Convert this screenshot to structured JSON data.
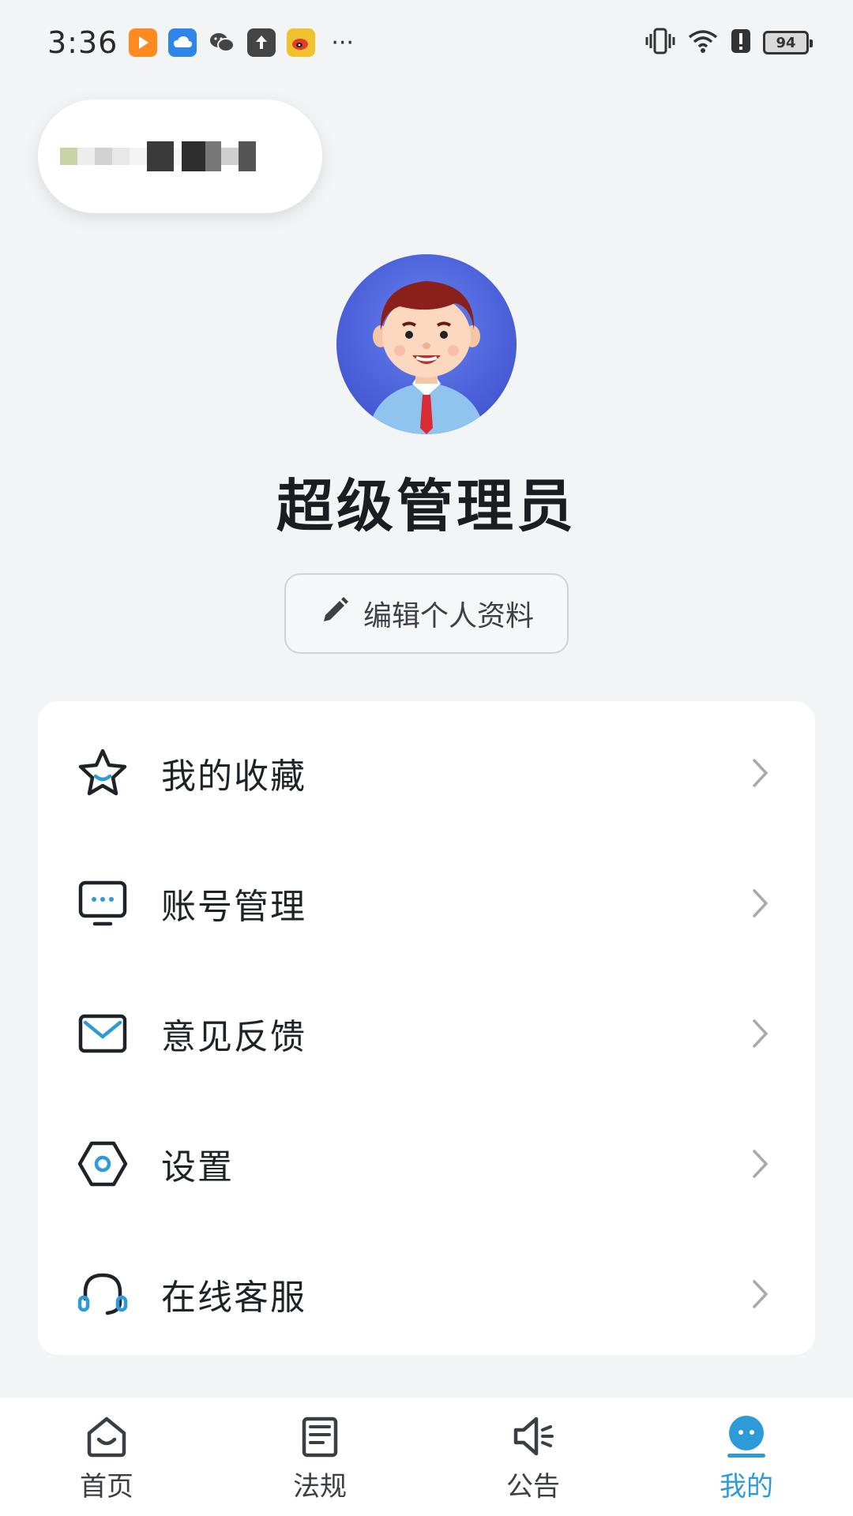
{
  "status_bar": {
    "time": "3:36",
    "battery": "94",
    "more": "···",
    "app_icons": [
      "video-app-icon",
      "cloud-icon",
      "wechat-icon",
      "upload-icon",
      "weibo-icon"
    ],
    "system_icons": [
      "vibrate-icon",
      "wifi-icon",
      "alert-icon",
      "battery-icon"
    ]
  },
  "profile": {
    "name": "超级管理员",
    "edit_label": "编辑个人资料"
  },
  "menu": {
    "items": [
      {
        "label": "我的收藏",
        "icon": "star-icon"
      },
      {
        "label": "账号管理",
        "icon": "monitor-chat-icon"
      },
      {
        "label": "意见反馈",
        "icon": "mail-icon"
      },
      {
        "label": "设置",
        "icon": "hexagon-gear-icon"
      },
      {
        "label": "在线客服",
        "icon": "headset-icon"
      }
    ]
  },
  "bottom_nav": {
    "items": [
      {
        "label": "首页",
        "icon": "home-icon"
      },
      {
        "label": "法规",
        "icon": "document-icon"
      },
      {
        "label": "公告",
        "icon": "speaker-icon"
      },
      {
        "label": "我的",
        "icon": "profile-bubble-icon"
      }
    ],
    "active_index": 3
  },
  "colors": {
    "accent": "#2d9bd8",
    "background": "#f3f4f6",
    "avatar_bg": "#4a5fd8"
  }
}
